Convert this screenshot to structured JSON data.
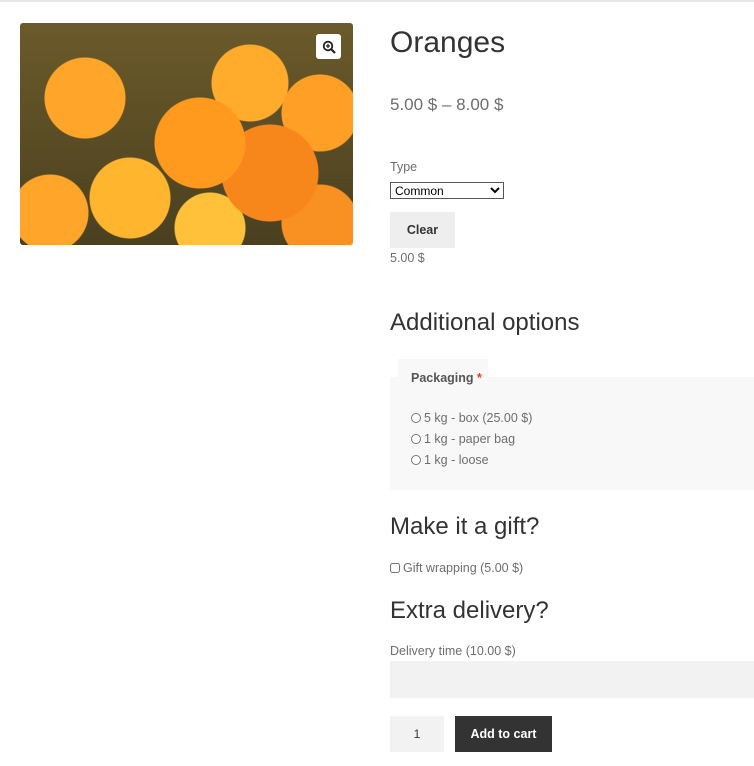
{
  "product": {
    "title": "Oranges",
    "price_range": "5.00 $ – 8.00 $",
    "type_label": "Type",
    "type_value": "Common",
    "clear_label": "Clear",
    "variation_price": "5.00 $"
  },
  "additional": {
    "heading": "Additional options",
    "packaging_label": "Packaging",
    "required_mark": "*",
    "options": [
      "5 kg - box (25.00 $)",
      "1 kg - paper bag",
      "1 kg - loose"
    ]
  },
  "gift": {
    "heading": "Make it a gift?",
    "checkbox_label": "Gift wrapping (5.00 $)"
  },
  "delivery": {
    "heading": "Extra delivery?",
    "field_label": "Delivery time (10.00 $)",
    "field_value": ""
  },
  "cart": {
    "quantity": "1",
    "button_label": "Add to cart"
  }
}
